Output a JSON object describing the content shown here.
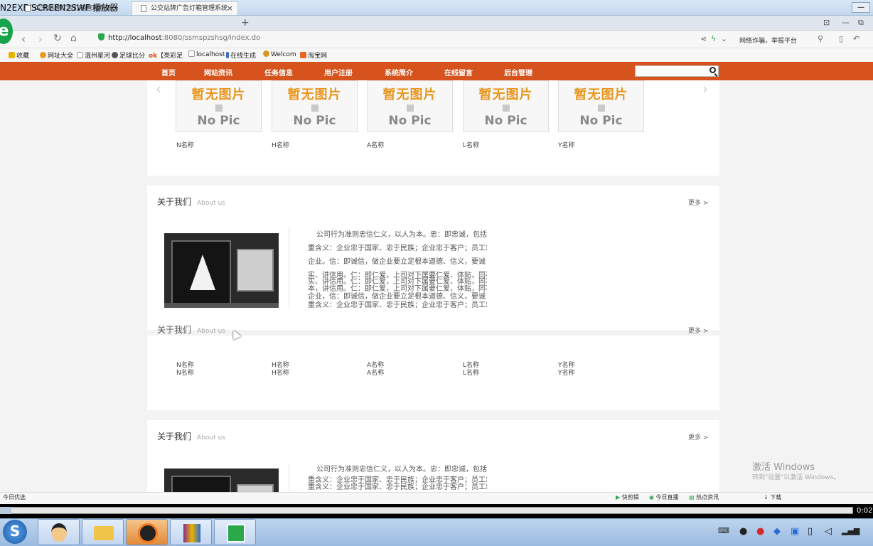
{
  "player": {
    "title": "N2EXE/SCREEN2SWF 播放器",
    "time": "0:02"
  },
  "browser": {
    "tabs": [
      {
        "label": "公交站牌广告灯箱管理系统",
        "active": false
      },
      {
        "label": "公交站牌广告灯箱管理系统",
        "active": true
      }
    ],
    "new_tab": "+",
    "close_tab": "×",
    "url_host": "http://localhost",
    "url_rest": ":8080/ssmspzshsg/index.do",
    "right_text": "网络诈骗，举报平台",
    "favorites": [
      "收藏",
      "网址大全",
      "温州星河",
      "足球比分",
      "【亮彩足",
      "localhost",
      "在线生成",
      "Welcom",
      "淘宝网"
    ]
  },
  "site": {
    "nav": [
      "首页",
      "网站资讯",
      "任务信息",
      "用户注册",
      "系统简介",
      "在线留言",
      "后台管理"
    ],
    "search_placeholder": ""
  },
  "products": {
    "no_pic_cn": "暂无图片",
    "no_pic_en": "No Pic",
    "names": [
      "N名称",
      "H名称",
      "A名称",
      "L名称",
      "Y名称"
    ],
    "prev": "‹",
    "next": "›"
  },
  "about": {
    "title": "关于我们",
    "subtitle": "About us",
    "more": "更多 >",
    "lines": [
      "公司行为准则忠信仁义，以人为本。忠：即忠诚，包括三",
      "重含义：企业忠于国家、忠于民族；企业忠于客户；员工忠于",
      "企业。信：即诚信，做企业要立足根本道德、信义，要诚",
      "实、讲信用。仁：即仁爱，上司对下属要仁爱、体贴，同事",
      "实、讲信用。仁：即仁爱，上司对下属要仁爱、体贴，同事",
      "本，讲信用。仁：即仁爱，上司对下属要仁爱、体贴，同事",
      "企业，信：即诚信，做企业要立足根本道德、信义，要诚",
      "重含义：企业忠于国家、忠于民族；企业忠于客户；员工忠于"
    ],
    "lines_bottom": [
      "公司行为准则忠信仁义，以人为本。忠：即忠诚，包括三",
      "重含义：企业忠于国家、忠于民族；企业忠于客户；员工忠于",
      "重含义：企业忠于国家、忠于民族；企业忠于客户；员工忠于"
    ]
  },
  "status": {
    "left": "今日优选",
    "items": [
      "快剪辑",
      "今日直播",
      "热点资讯",
      "下载"
    ]
  },
  "watermark": {
    "line1": "激活 Windows",
    "line2": "转到\"设置\"以激活 Windows。"
  }
}
